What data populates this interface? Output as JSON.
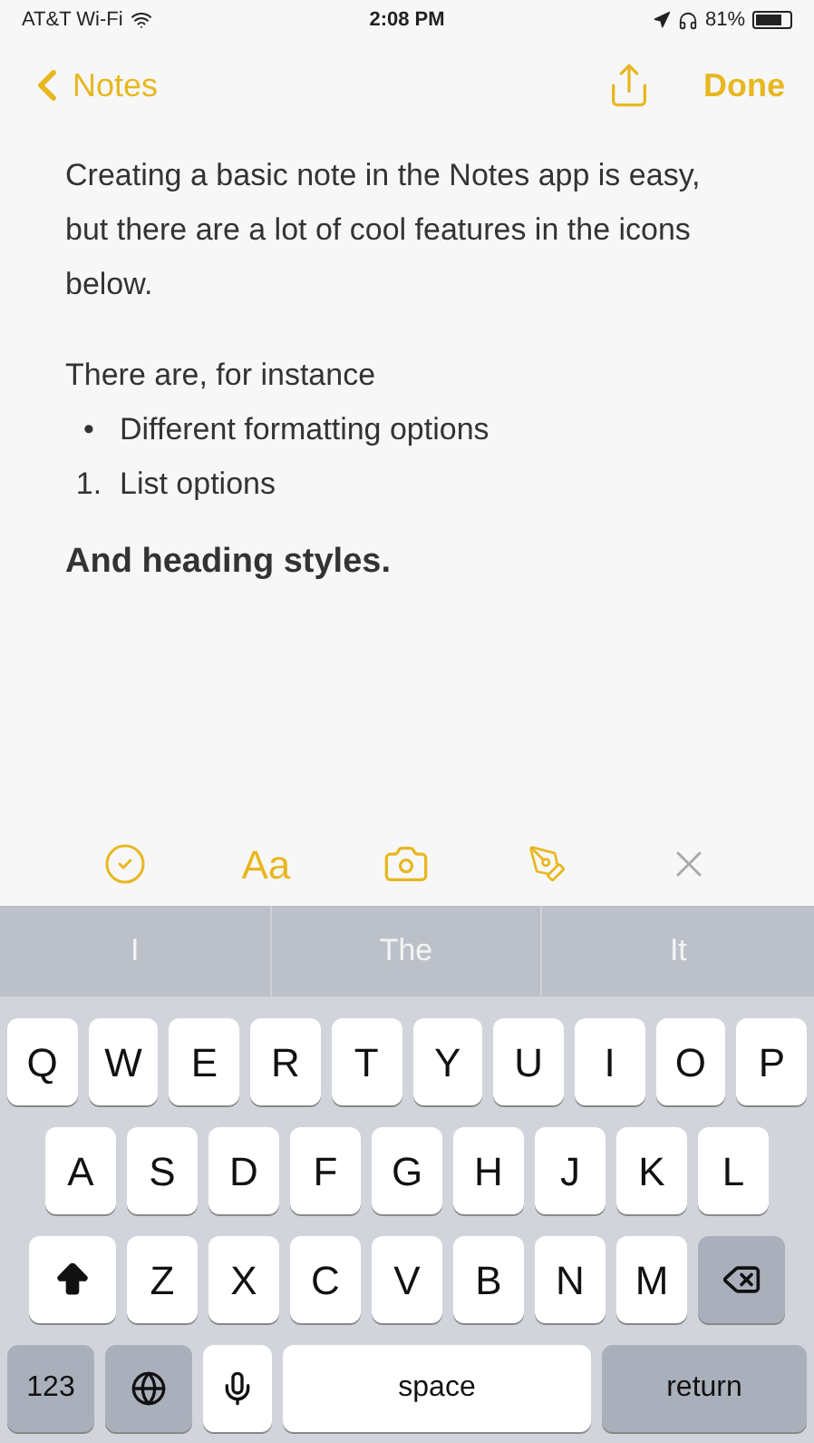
{
  "status_bar": {
    "carrier": "AT&T Wi-Fi",
    "time": "2:08 PM",
    "battery": "81%"
  },
  "nav": {
    "back": "Notes",
    "done": "Done"
  },
  "note": [
    {
      "kind": "paragraph",
      "text": "Creating a basic note in the Notes app is easy, but there are a lot of cool features in the icons below."
    },
    {
      "kind": "spacer"
    },
    {
      "kind": "paragraph",
      "text": "There are, for instance"
    },
    {
      "kind": "list_item",
      "marker": "•",
      "text": "Different formatting options"
    },
    {
      "kind": "list_item",
      "marker": "1.",
      "text": "List options"
    },
    {
      "kind": "heading",
      "text": "And heading styles."
    }
  ],
  "toolbar": [
    {
      "kind": "checklist"
    },
    {
      "kind": "format",
      "label": "Aa"
    },
    {
      "kind": "camera"
    },
    {
      "kind": "sketch"
    },
    {
      "kind": "close"
    }
  ],
  "suggestions": [
    "I",
    "The",
    "It"
  ],
  "keyboard": [
    [
      {
        "kind": "letter",
        "label": "Q"
      },
      {
        "kind": "letter",
        "label": "W"
      },
      {
        "kind": "letter",
        "label": "E"
      },
      {
        "kind": "letter",
        "label": "R"
      },
      {
        "kind": "letter",
        "label": "T"
      },
      {
        "kind": "letter",
        "label": "Y"
      },
      {
        "kind": "letter",
        "label": "U"
      },
      {
        "kind": "letter",
        "label": "I"
      },
      {
        "kind": "letter",
        "label": "O"
      },
      {
        "kind": "letter",
        "label": "P"
      }
    ],
    [
      {
        "kind": "letter",
        "label": "A"
      },
      {
        "kind": "letter",
        "label": "S"
      },
      {
        "kind": "letter",
        "label": "D"
      },
      {
        "kind": "letter",
        "label": "F"
      },
      {
        "kind": "letter",
        "label": "G"
      },
      {
        "kind": "letter",
        "label": "H"
      },
      {
        "kind": "letter",
        "label": "J"
      },
      {
        "kind": "letter",
        "label": "K"
      },
      {
        "kind": "letter",
        "label": "L"
      }
    ],
    [
      {
        "kind": "shift"
      },
      {
        "kind": "letter",
        "label": "Z"
      },
      {
        "kind": "letter",
        "label": "X"
      },
      {
        "kind": "letter",
        "label": "C"
      },
      {
        "kind": "letter",
        "label": "V"
      },
      {
        "kind": "letter",
        "label": "B"
      },
      {
        "kind": "letter",
        "label": "N"
      },
      {
        "kind": "letter",
        "label": "M"
      },
      {
        "kind": "delete"
      }
    ],
    [
      {
        "kind": "mode",
        "label": "123"
      },
      {
        "kind": "globe"
      },
      {
        "kind": "mic"
      },
      {
        "kind": "space",
        "label": "space"
      },
      {
        "kind": "return",
        "label": "return"
      }
    ]
  ]
}
